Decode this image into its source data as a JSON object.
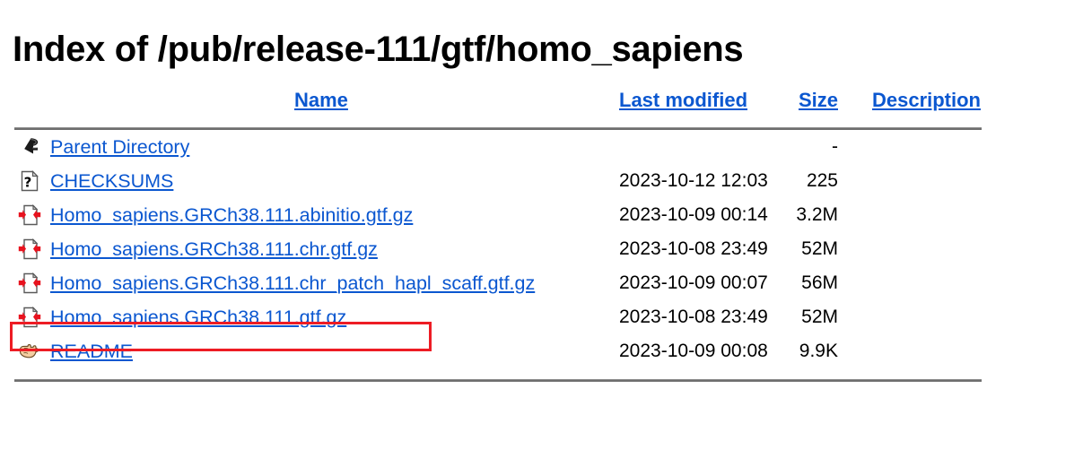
{
  "page": {
    "title": "Index of /pub/release-111/gtf/homo_sapiens"
  },
  "colors": {
    "link": "#0b57d0",
    "rule": "#6e6e6e",
    "highlight": "#ed1c24",
    "text": "#000000",
    "background": "#ffffff"
  },
  "table": {
    "headers": {
      "name": "Name",
      "last_modified": "Last modified",
      "size": "Size",
      "description": "Description"
    },
    "rows": [
      {
        "icon": "back-arrow-icon",
        "name": "Parent Directory",
        "last_modified": "",
        "size": "-",
        "description": ""
      },
      {
        "icon": "unknown-file-icon",
        "name": "CHECKSUMS",
        "last_modified": "2023-10-12 12:03",
        "size": "225",
        "description": ""
      },
      {
        "icon": "compressed-file-icon",
        "name": "Homo_sapiens.GRCh38.111.abinitio.gtf.gz",
        "last_modified": "2023-10-09 00:14",
        "size": "3.2M",
        "description": ""
      },
      {
        "icon": "compressed-file-icon",
        "name": "Homo_sapiens.GRCh38.111.chr.gtf.gz",
        "last_modified": "2023-10-08 23:49",
        "size": "52M",
        "description": ""
      },
      {
        "icon": "compressed-file-icon",
        "name": "Homo_sapiens.GRCh38.111.chr_patch_hapl_scaff.gtf.gz",
        "last_modified": "2023-10-09 00:07",
        "size": "56M",
        "description": ""
      },
      {
        "icon": "compressed-file-icon",
        "name": "Homo_sapiens.GRCh38.111.gtf.gz",
        "last_modified": "2023-10-08 23:49",
        "size": "52M",
        "description": "",
        "highlighted": true
      },
      {
        "icon": "hand-right-icon",
        "name": "README",
        "last_modified": "2023-10-09 00:08",
        "size": "9.9K",
        "description": ""
      }
    ]
  }
}
